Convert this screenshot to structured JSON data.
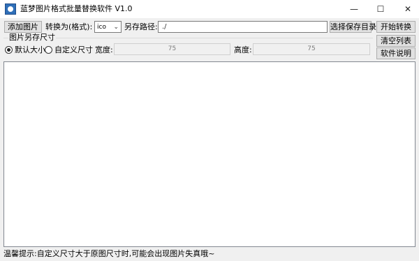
{
  "window": {
    "title": "蓝梦图片格式批量替换软件 V1.0",
    "minimize_glyph": "—",
    "maximize_glyph": "☐",
    "close_glyph": "✕"
  },
  "toolbar": {
    "add_image_label": "添加图片",
    "convert_label": "转换为(格式):",
    "format_value": "ico",
    "save_path_label": "另存路径:",
    "save_path_value": "./",
    "choose_dir_label": "选择保存目录"
  },
  "size_group": {
    "title": "图片另存尺寸",
    "default_label": "默认大小",
    "default_selected": true,
    "custom_label": "自定义尺寸",
    "width_label": "宽度:",
    "width_value": "75",
    "height_label": "高度:",
    "height_value": "75"
  },
  "side_buttons": {
    "start_label": "开始转换",
    "clear_label": "清空列表",
    "help_label": "软件说明"
  },
  "file_list": {
    "items": []
  },
  "status": {
    "text": "温馨提示:自定义尺寸大于原图尺寸时,可能会出现图片失真哦~"
  },
  "colors": {
    "background": "#f0f0f0",
    "button": "#e1e1e1",
    "list_background": "#ffffff"
  },
  "icons": {
    "app": "app-icon",
    "dropdown": "chevron-down-icon"
  }
}
